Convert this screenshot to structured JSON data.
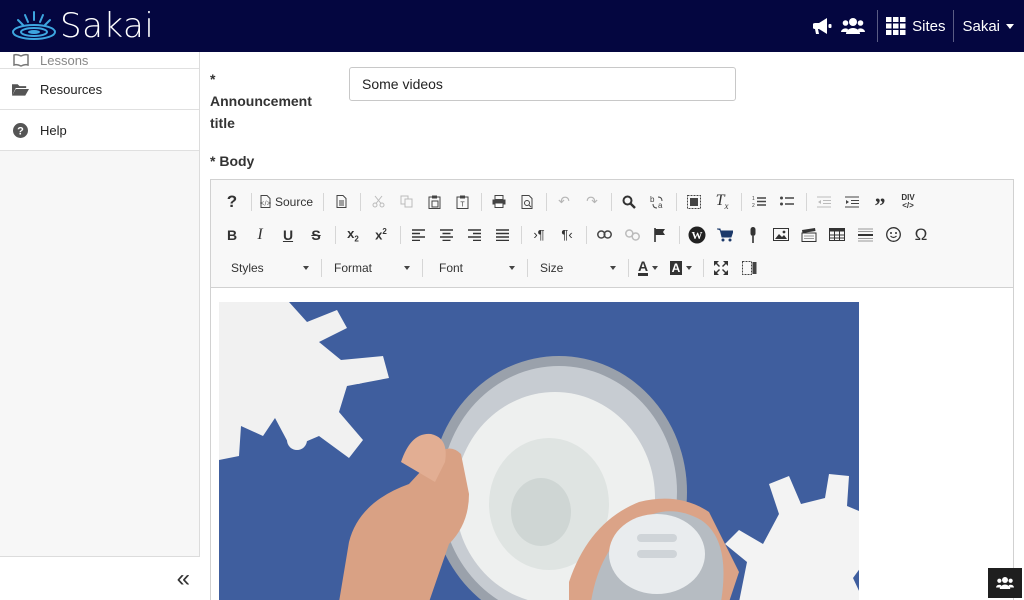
{
  "header": {
    "logo_text": "Sakai",
    "sites_label": "Sites",
    "user_label": "Sakai",
    "icons": [
      "megaphone-icon",
      "users-icon",
      "grid-icon"
    ]
  },
  "sidebar": {
    "items": [
      {
        "label": "Lessons",
        "icon": "book-icon"
      },
      {
        "label": "Resources",
        "icon": "folder-open-icon"
      },
      {
        "label": "Help",
        "icon": "question-circle-icon"
      }
    ],
    "collapse_glyph": "«"
  },
  "form": {
    "title_label_star": "*",
    "title_label": "Announcement title",
    "title_value": "Some videos",
    "body_label": "* Body"
  },
  "editor": {
    "source_label": "Source",
    "styles_label": "Styles",
    "format_label": "Format",
    "font_label": "Font",
    "size_label": "Size",
    "text_color_glyph": "A",
    "bg_color_glyph": "A",
    "omega_glyph": "Ω"
  },
  "colors": {
    "header_bg": "#040640",
    "video_bg": "#3f5e9e"
  }
}
